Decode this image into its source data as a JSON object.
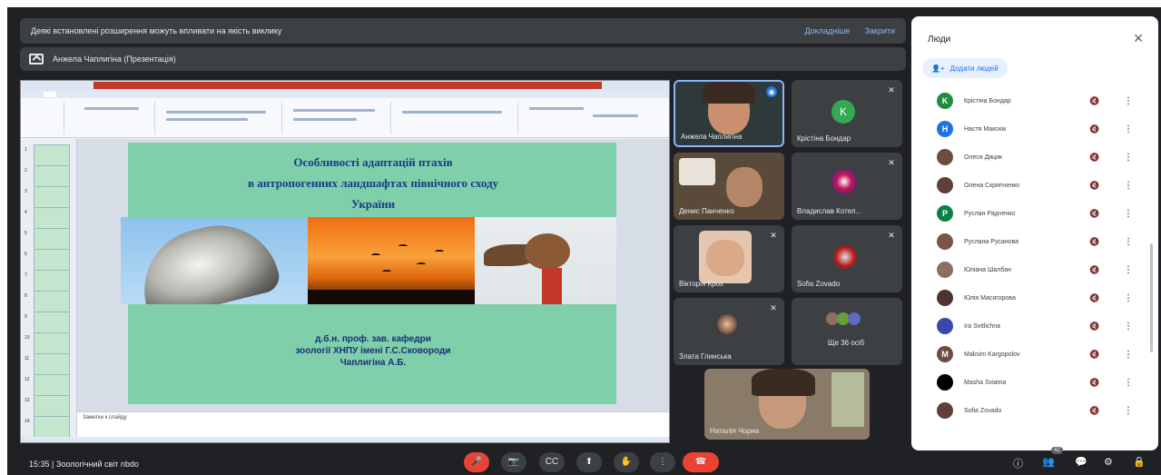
{
  "notice": {
    "text": "Деякі встановлені розширення можуть впливати на якість виклику",
    "details": "Докладніше",
    "close": "Закрити"
  },
  "presenting": {
    "text": "Анжела Чаплигіна (Презентація)"
  },
  "slide": {
    "title_line1": "Особливості адаптацій птахів",
    "title_line2": "в антропогенних ландшафтах північного сходу",
    "title_line3": "України",
    "author_line1": "д.б.н. проф. зав. кафедри",
    "author_line2": "зоології ХНПУ імені Г.С.Сковороди",
    "author_line3": "Чаплигіна А.Б.",
    "notes": "Заметки к слайду"
  },
  "thumbs": [
    "1",
    "2",
    "3",
    "4",
    "5",
    "6",
    "7",
    "8",
    "9",
    "10",
    "11",
    "12",
    "13",
    "14"
  ],
  "tiles": [
    {
      "name": "Анжела Чаплигіна",
      "avatar": "",
      "color": "#2e3a3a"
    },
    {
      "name": "Крістіна Бондар",
      "avatar": "K",
      "color": "#34a853"
    },
    {
      "name": "Денис Панченко",
      "avatar": "",
      "color": "#4a3a2a"
    },
    {
      "name": "Владислав Котел...",
      "avatar": "",
      "color": "#3c4043"
    },
    {
      "name": "Вікторія Крох",
      "avatar": "",
      "color": "#6a5a48"
    },
    {
      "name": "Sofia Zovado",
      "avatar": "",
      "color": "#3c4043"
    },
    {
      "name": "Злата Глинська",
      "avatar": "",
      "color": "#3c4043"
    },
    {
      "name": "Ще 36 осіб",
      "avatar": "",
      "color": "#3c4043"
    },
    {
      "name": "Наталія Чорна",
      "avatar": "",
      "color": "#8a7a68"
    }
  ],
  "people": {
    "title": "Люди",
    "add_button": "Додати людей",
    "list": [
      {
        "name": "Крістіна Бондар",
        "initial": "K",
        "color": "#1e8e3e"
      },
      {
        "name": "Настя Максюк",
        "initial": "Н",
        "color": "#1a73e8"
      },
      {
        "name": "Олеся Дяцик",
        "initial": "",
        "color": "#6d4c41"
      },
      {
        "name": "Олена Скрипченко",
        "initial": "",
        "color": "#5d4037"
      },
      {
        "name": "Руслан Радченко",
        "initial": "Р",
        "color": "#0b8043"
      },
      {
        "name": "Руслана Русанова",
        "initial": "",
        "color": "#795548"
      },
      {
        "name": "Юліана Шалбан",
        "initial": "",
        "color": "#8d6e63"
      },
      {
        "name": "Юлія Масягорова",
        "initial": "",
        "color": "#4e342e"
      },
      {
        "name": "Ira Svitlichna",
        "initial": "",
        "color": "#3949ab"
      },
      {
        "name": "Maksim Kargopolov",
        "initial": "M",
        "color": "#6d4c41"
      },
      {
        "name": "Masha Sviatna",
        "initial": "",
        "color": "#000000"
      },
      {
        "name": "Sofia Zovado",
        "initial": "",
        "color": "#5d4037"
      }
    ]
  },
  "bottom": {
    "time": "15:35",
    "separator": "|",
    "meeting": "Зоологічний світ nbdo",
    "badge": "42"
  },
  "controls": {
    "mic": "🎤",
    "camera": "📷",
    "captions": "CC",
    "present": "⬆",
    "hand": "✋",
    "more": "⋮",
    "hangup": "☎"
  },
  "right_icons": {
    "info": "ⓘ",
    "people": "👥",
    "chat": "💬",
    "activities": "⚙",
    "lock": "🔒"
  }
}
